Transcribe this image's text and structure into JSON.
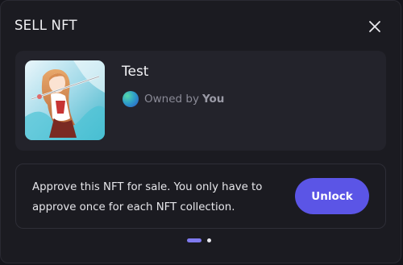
{
  "modal": {
    "title": "SELL NFT",
    "close_icon": "close-icon"
  },
  "nft": {
    "name": "Test",
    "owner_label": "Owned by",
    "owner_name": "You",
    "avatar_icon": "owner-avatar-icon"
  },
  "approval": {
    "message": "Approve this NFT for sale. You only have to approve once for each NFT collection.",
    "button_label": "Unlock"
  },
  "pagination": {
    "current_step": 1,
    "total_steps": 2
  },
  "colors": {
    "background": "#1b1b21",
    "card": "#23232b",
    "accent": "#5b55e6",
    "text_primary": "#f1f1f4",
    "text_muted": "#8a8a96"
  }
}
